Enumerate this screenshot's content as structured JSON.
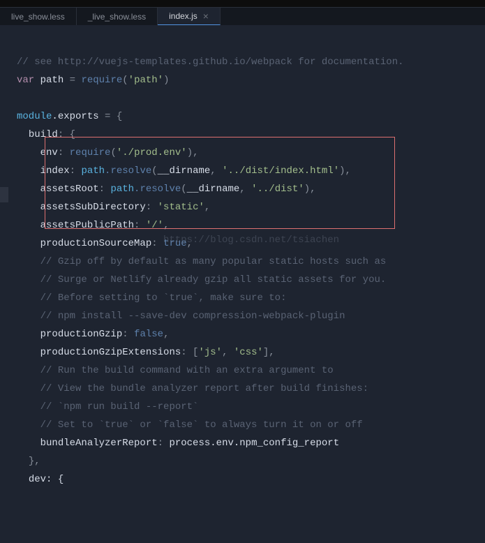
{
  "menubar": "",
  "tabs": [
    {
      "label": "live_show.less",
      "active": false,
      "closable": false
    },
    {
      "label": "_live_show.less",
      "active": false,
      "closable": false
    },
    {
      "label": "index.js",
      "active": true,
      "closable": true
    }
  ],
  "watermark": "https://blog.csdn.net/tsiachen",
  "code": {
    "l1": "// see http://vuejs-templates.github.io/webpack for documentation.",
    "l2_kw": "var",
    "l2_name": "path",
    "l2_eq": " = ",
    "l2_fn": "require",
    "l2_arg": "'path'",
    "l3_mod": "module",
    "l3_exp": ".exports",
    "l3_rest": " = {",
    "l4_key": "build",
    "l4_rest": ": {",
    "l5_key": "env",
    "l5_fn": "require",
    "l5_arg": "'./prod.env'",
    "l6_key": "index",
    "l6_obj": "path",
    "l6_m": ".resolve",
    "l6_a1": "__dirname",
    "l6_a2": "'../dist/index.html'",
    "l7_key": "assetsRoot",
    "l7_obj": "path",
    "l7_m": ".resolve",
    "l7_a1": "__dirname",
    "l7_a2": "'../dist'",
    "l8_key": "assetsSubDirectory",
    "l8_val": "'static'",
    "l9_key": "assetsPublicPath",
    "l9_val": "'/'",
    "l10_key": "productionSourceMap",
    "l10_val": "true",
    "l11": "// Gzip off by default as many popular static hosts such as",
    "l12": "// Surge or Netlify already gzip all static assets for you.",
    "l13": "// Before setting to `true`, make sure to:",
    "l14": "// npm install --save-dev compression-webpack-plugin",
    "l15_key": "productionGzip",
    "l15_val": "false",
    "l16_key": "productionGzipExtensions",
    "l16_v1": "'js'",
    "l16_v2": "'css'",
    "l17": "// Run the build command with an extra argument to",
    "l18": "// View the bundle analyzer report after build finishes:",
    "l19": "// `npm run build --report`",
    "l20": "// Set to `true` or `false` to always turn it on or off",
    "l21_key": "bundleAnalyzerReport",
    "l21_val": "process.env.npm_config_report",
    "l22": "},",
    "l23": "dev: {"
  }
}
